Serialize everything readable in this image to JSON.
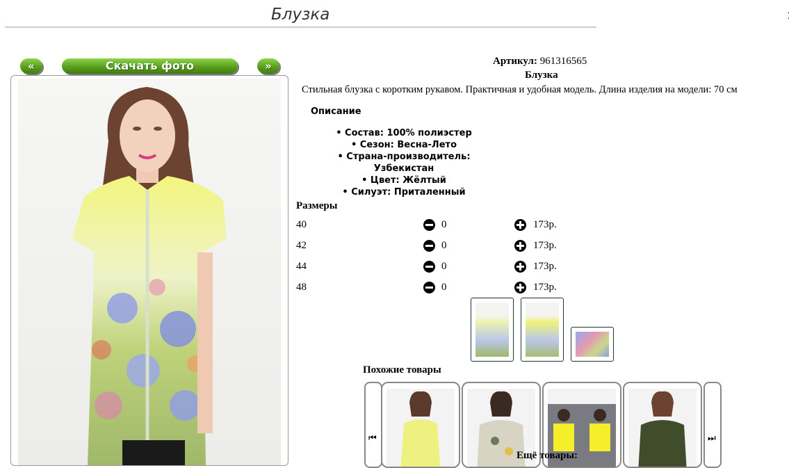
{
  "page": {
    "title": "Блузка",
    "close_glyph": "×"
  },
  "nav": {
    "prev_label": "«",
    "download_label": "Скачать фото",
    "next_label": "»"
  },
  "product": {
    "article_label": "Артикул:",
    "article_value": "961316565",
    "name": "Блузка",
    "description": "Стильная блузка с коротким рукавом. Практичная и удобная модель. Длина изделия на модели: 70 см",
    "description_heading": "Описание",
    "attributes": [
      "• Состав: 100% полиэстер",
      "• Сезон: Весна-Лето",
      "• Страна-производитель: Узбекистан",
      "• Цвет: Жёлтый",
      "• Силуэт: Приталенный"
    ]
  },
  "sizes": {
    "heading": "Размеры",
    "rows": [
      {
        "size": "40",
        "qty": "0",
        "price": "173р."
      },
      {
        "size": "42",
        "qty": "0",
        "price": "173р."
      },
      {
        "size": "44",
        "qty": "0",
        "price": "173р."
      },
      {
        "size": "48",
        "qty": "0",
        "price": "173р."
      }
    ]
  },
  "similar": {
    "heading": "Похожие товары",
    "prev_glyph": "⏮",
    "next_glyph": "⏭"
  },
  "more": {
    "heading": "Ещё товары:"
  },
  "colors": {
    "accent_green": "#5a9e1e",
    "blouse_yellow": "#f0f37a"
  }
}
